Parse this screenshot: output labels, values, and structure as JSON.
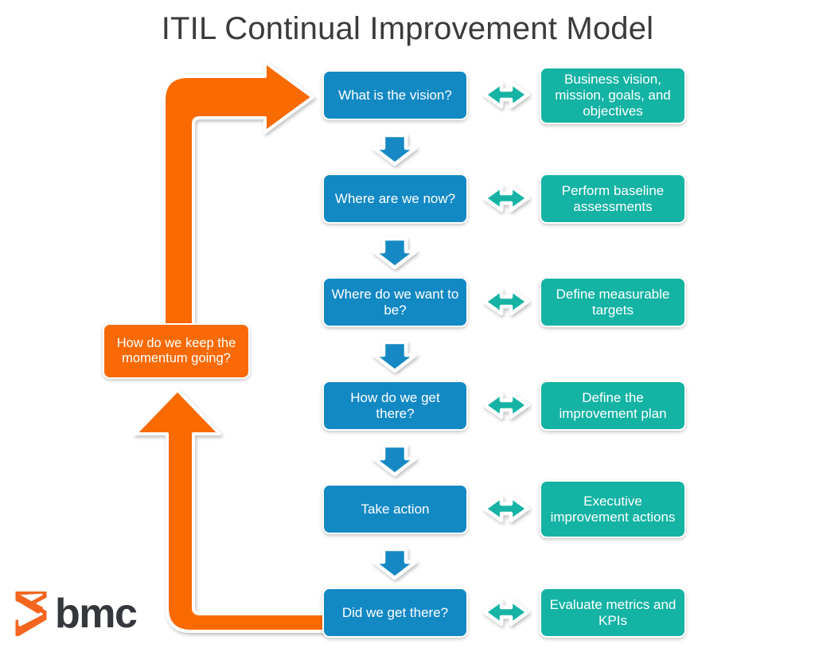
{
  "page": {
    "title": "ITIL Continual Improvement Model",
    "background_color": "#ffffff"
  },
  "colors": {
    "stage_blue": "#1389c4",
    "output_teal": "#14b3a4",
    "momentum_orange": "#f96a06",
    "loop_arrow_orange": "#f96a06",
    "connector_blue": "#1389c4",
    "link_arrow_teal": "#14b3a4",
    "title_text": "#3b3b3b",
    "box_text": "#ffffff",
    "box_border": "#ffffff",
    "logo_mark": "#f4661f",
    "logo_word": "#34383c"
  },
  "steps": [
    {
      "id": "vision",
      "question": "What is the vision?",
      "output": "Business vision, mission, goals, and objectives",
      "link_icon": "double-arrow-icon"
    },
    {
      "id": "where-now",
      "question": "Where are we now?",
      "output": "Perform baseline assessments",
      "link_icon": "double-arrow-icon"
    },
    {
      "id": "where-want",
      "question": "Where do we want to be?",
      "output": "Define measurable targets",
      "link_icon": "double-arrow-icon"
    },
    {
      "id": "how-get-there",
      "question": "How do we get there?",
      "output": "Define the improvement plan",
      "link_icon": "double-arrow-icon"
    },
    {
      "id": "take-action",
      "question": "Take action",
      "output": "Executive improvement actions",
      "link_icon": "double-arrow-icon"
    },
    {
      "id": "did-we-get-there",
      "question": "Did we get there?",
      "output": "Evaluate metrics and KPIs",
      "link_icon": "double-arrow-icon"
    }
  ],
  "momentum": {
    "label": "How do we keep the momentum going?"
  },
  "connectors": {
    "down_arrow_icon": "arrow-down-icon",
    "down_arrow_count": 5,
    "loop_return_icon": "loop-arrow-up-left-icon",
    "loop_start_icon": "loop-arrow-right-icon"
  },
  "logo": {
    "wordmark": "bmc",
    "mark_icon": "bmc-chevron-icon"
  }
}
